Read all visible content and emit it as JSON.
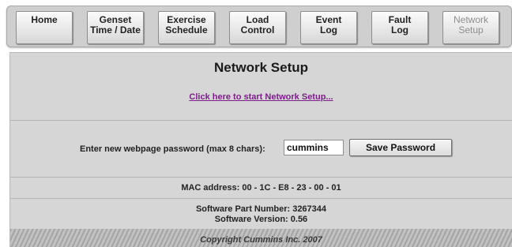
{
  "nav": {
    "tabs": [
      {
        "line1": "Home",
        "line2": "",
        "disabled": false
      },
      {
        "line1": "Genset",
        "line2": "Time / Date",
        "disabled": false
      },
      {
        "line1": "Exercise",
        "line2": "Schedule",
        "disabled": false
      },
      {
        "line1": "Load",
        "line2": "Control",
        "disabled": false
      },
      {
        "line1": "Event",
        "line2": "Log",
        "disabled": false
      },
      {
        "line1": "Fault",
        "line2": "Log",
        "disabled": false
      },
      {
        "line1": "Network",
        "line2": "Setup",
        "disabled": true
      }
    ]
  },
  "main": {
    "title": "Network Setup",
    "setup_link": "Click here to start Network Setup...",
    "password_label": "Enter new webpage password (max 8 chars):",
    "password_value": "cummins",
    "save_button": "Save Password",
    "mac_text": "MAC address: 00 - 1C - E8 - 23 - 00 - 01",
    "software_part": "Software Part Number: 3267344",
    "software_version": "Software Version: 0.56",
    "copyright": "Copyright Cummins Inc. 2007"
  },
  "colors": {
    "panel_bg": "#d6d6d6",
    "link": "#7d1d8a",
    "disabled_tab_text": "#8e8e8e"
  }
}
